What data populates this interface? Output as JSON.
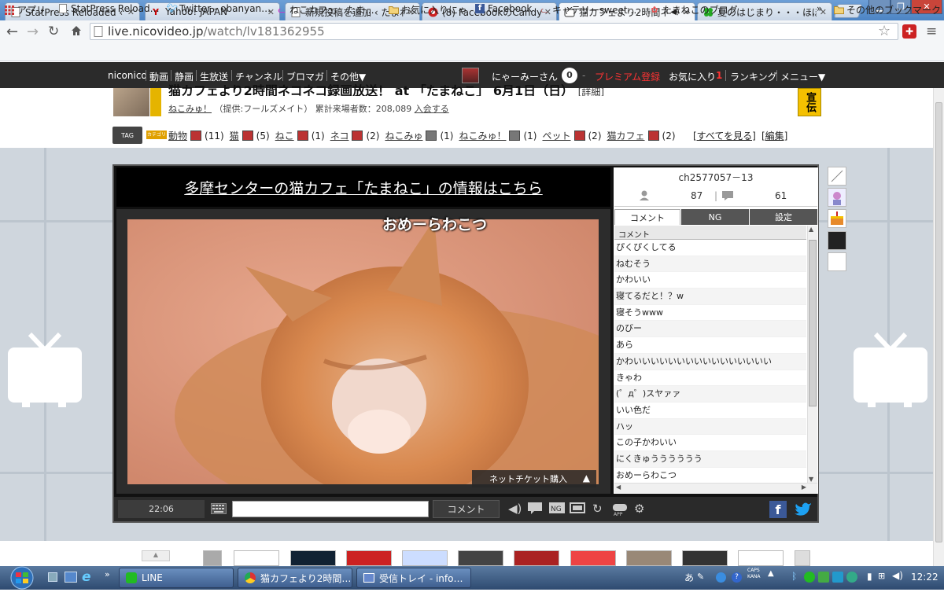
{
  "browser": {
    "tabs": [
      {
        "label": "StatPress Reloaded ‹ お",
        "icon": "page-icon"
      },
      {
        "label": "Yahoo! JAPAN",
        "icon": "yahoo-icon"
      },
      {
        "label": "新規投稿を追加 ‹ たまね",
        "icon": "page-icon"
      },
      {
        "label": "(8) FacebookのCandy C",
        "icon": "candy-icon"
      },
      {
        "label": "猫カフェより2時間ネ",
        "icon": "niconico-icon",
        "active": true
      },
      {
        "label": "夏のはじまり・・・ほぼ",
        "icon": "clover-icon"
      }
    ],
    "url_host": "live.nicovideo.jp",
    "url_path": "/watch/lv181362955",
    "bookmarks": [
      {
        "label": "アプリ",
        "icon": "apps-icon"
      },
      {
        "label": "StatPress Reload…",
        "icon": "page-icon"
      },
      {
        "label": "Twitter - obanyan…",
        "icon": "twitter-icon"
      },
      {
        "label": "ねこカフェ　たま…",
        "icon": "cat-icon"
      },
      {
        "label": "お気に入りにゃ",
        "icon": "folder-icon"
      },
      {
        "label": "Facebook",
        "icon": "facebook-icon"
      },
      {
        "label": "キャテリーsweet …",
        "icon": "cat-face-icon"
      },
      {
        "label": "たまねこのブログ",
        "icon": "paw-icon"
      }
    ],
    "bookmarks_more": "»",
    "other_bookmarks": "その他のブックマーク"
  },
  "nico": {
    "nav": [
      "niconico",
      "動画",
      "静画",
      "生放送",
      "チャンネル",
      "ブロマガ",
      "その他▼"
    ],
    "user": "にゃーみーさん",
    "premium": "プレミアム登録",
    "favorites": "お気に入り",
    "ranking": "ランキング",
    "menu": "メニュー▼"
  },
  "program": {
    "title": "猫カフェより2時間ネコネコ録画放送！ at 「たまねこ」 6月1日（日）",
    "detail_link": "[詳細]",
    "community": "ねこみゅ！",
    "provider": "（提供:フールズメイト）",
    "visitors": "累計来場者数：208,089",
    "join": "入会する",
    "ad_label": "宣伝",
    "tags_label": "TAG",
    "category_label": "カテゴリ",
    "tags": [
      {
        "name": "動物",
        "count": "(11)"
      },
      {
        "name": "猫",
        "count": "(5)"
      },
      {
        "name": "ねこ",
        "count": "(1)"
      },
      {
        "name": "ネコ",
        "count": "(2)"
      },
      {
        "name": "ねこみゅ",
        "count": "(1)"
      },
      {
        "name": "ねこみゅ！",
        "count": "(1)"
      },
      {
        "name": "ペット",
        "count": "(2)"
      },
      {
        "name": "猫カフェ",
        "count": "(2)"
      }
    ],
    "see_all": "[すべてを見る]",
    "edit": "[編集]"
  },
  "player": {
    "banner": "多摩センターの猫カフェ「たまねこ」の情報はこちら",
    "overlay_comment": "おめーらわこつ",
    "ticket": "ネットチケット購入",
    "time": "22:06",
    "comment_button": "コメント"
  },
  "panel": {
    "channel_id": "ch2577057－13",
    "viewers": "87",
    "comments": "61",
    "tabs": [
      "コメント",
      "NG",
      "設定"
    ],
    "list_header": "コメント",
    "comments_list": [
      "ぴくぴくしてる",
      "ねむそう",
      "かわいい",
      "寝てるだと！？w",
      "寝そうwww",
      "のびー",
      "あら",
      "かわいいいいいいいいいいいいいいいい",
      "きゃわ",
      "(゜д゜)スヤァァ",
      "いい色だ",
      "ハッ",
      "この子かわいい",
      "にくきゅうううううう",
      "おめーらわこつ"
    ]
  },
  "taskbar": {
    "tasks": [
      "LINE",
      "猫カフェより2時間…",
      "受信トレイ - info…"
    ],
    "caps": "CAPS",
    "kana": "KANA",
    "ime": "あ",
    "clock": "12:22"
  }
}
